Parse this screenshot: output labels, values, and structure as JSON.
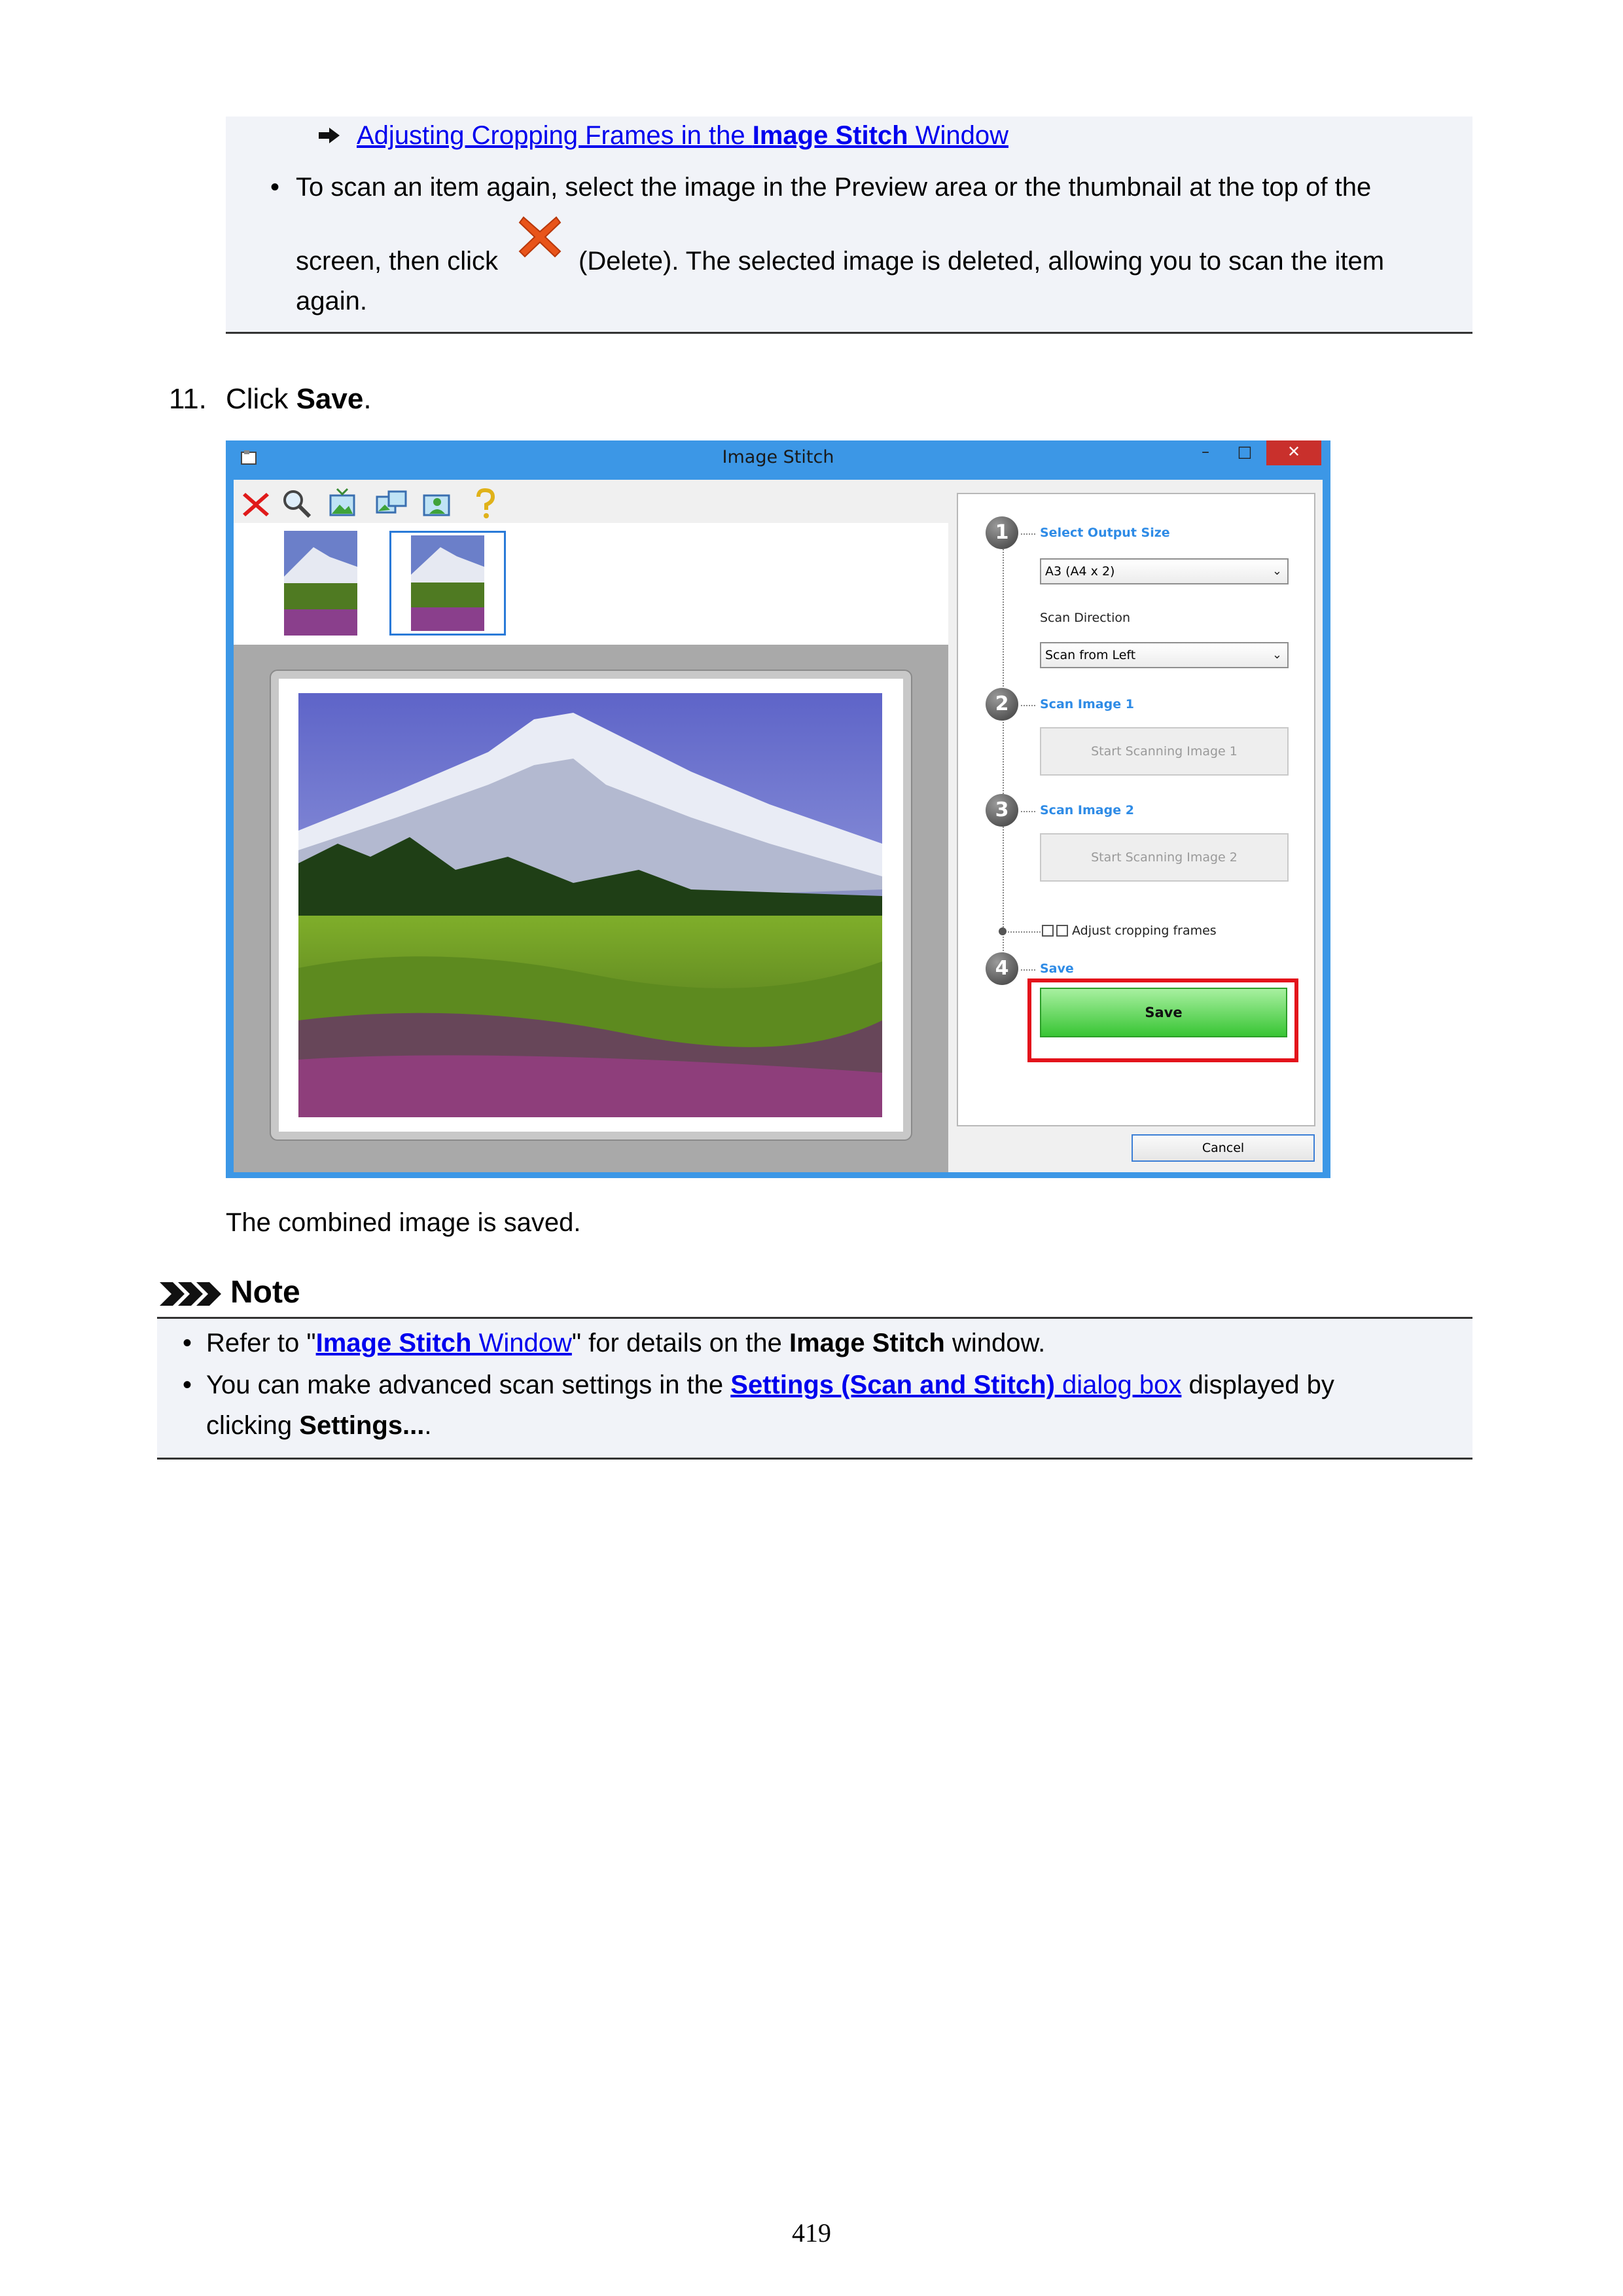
{
  "top_box": {
    "link": {
      "part1": "Adjusting Cropping Frames in the ",
      "part2_bold": "Image Stitch",
      "part3": " Window"
    },
    "bullet": "•",
    "line1": "To scan an item again, select the image in the Preview area or the thumbnail at the top of the",
    "line2a": "screen, then click",
    "line2b": "(Delete). The selected image is deleted, allowing you to scan the item",
    "line3": "again."
  },
  "step11": {
    "number": "11.",
    "text": "Click ",
    "bold": "Save",
    "end": "."
  },
  "window": {
    "title": "Image Stitch",
    "controls": {
      "minimize": "–",
      "maximize": "□",
      "close": "✕"
    },
    "toolbar_icons": [
      "delete-icon",
      "zoom-icon",
      "image-icon",
      "image-swap-icon",
      "image-person-icon",
      "help-icon"
    ],
    "panel": {
      "step1": {
        "num": "1",
        "label": "Select Output Size",
        "select_value": "A3 (A4 x 2)"
      },
      "scan_direction_label": "Scan Direction",
      "scan_direction_value": "Scan from Left",
      "step2": {
        "num": "2",
        "label": "Scan Image 1",
        "button": "Start Scanning Image 1"
      },
      "step3": {
        "num": "3",
        "label": "Scan Image 2",
        "button": "Start Scanning Image 2"
      },
      "adjust_label": "Adjust cropping frames",
      "step4": {
        "num": "4",
        "label": "Save",
        "button": "Save"
      },
      "cancel": "Cancel"
    },
    "colors": {
      "title_bar": "#3c97e6",
      "highlight": "#e3131b",
      "save_green": "#38c534",
      "step_label": "#2e8be6"
    }
  },
  "caption": "The combined image is saved.",
  "note": {
    "title": "Note",
    "bullet": "•",
    "item1": {
      "pre": "Refer to \"",
      "link_bold": "Image Stitch",
      "link_rest": " Window",
      "mid": "\" for details on the ",
      "bold": "Image Stitch",
      "post": " window."
    },
    "item2": {
      "pre": "You can make advanced scan settings in the ",
      "link_bold": "Settings (Scan and Stitch)",
      "link_rest": " dialog box",
      "post": " displayed by"
    },
    "item2_line2": {
      "pre": "clicking ",
      "bold": "Settings...",
      "post": "."
    }
  },
  "page_number": "419"
}
